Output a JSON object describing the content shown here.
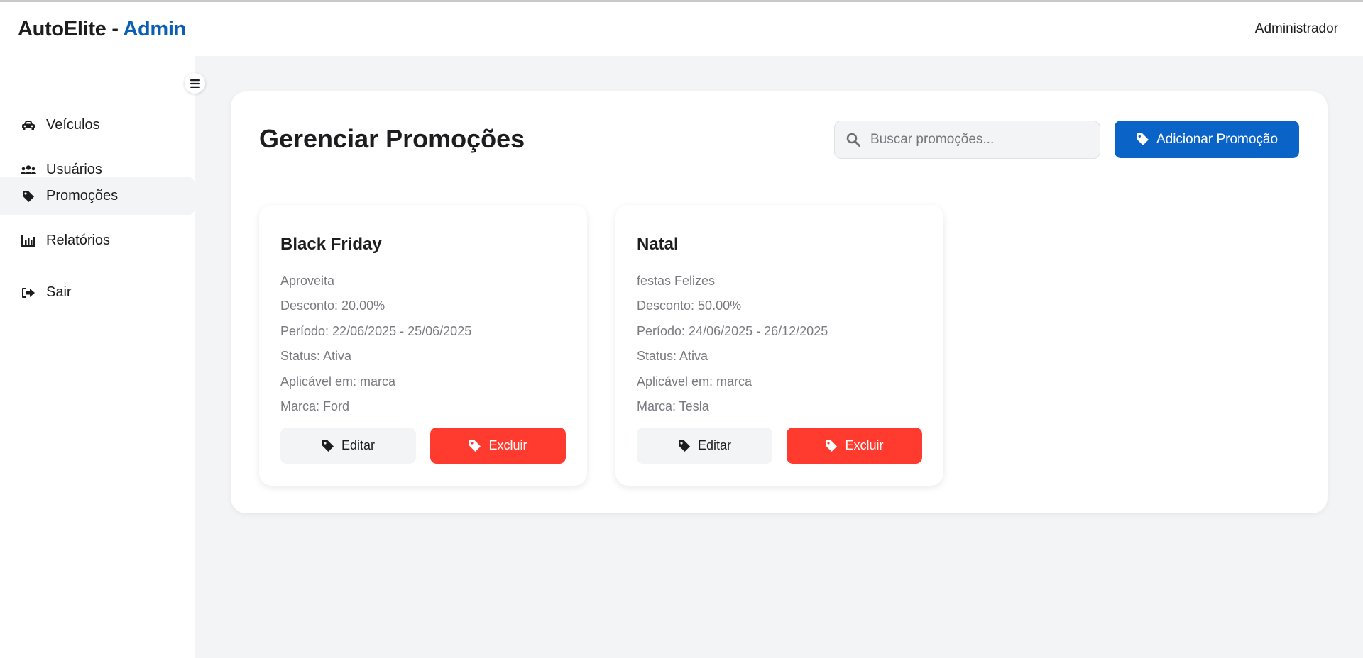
{
  "header": {
    "brand_main": "AutoElite",
    "brand_sep": " - ",
    "brand_accent": "Admin",
    "user_label": "Administrador"
  },
  "sidebar": {
    "items": [
      {
        "label": "Veículos",
        "icon": "car-icon"
      },
      {
        "label": "Usuários",
        "icon": "users-icon"
      },
      {
        "label": "Promoções",
        "icon": "tag-icon",
        "active": true
      },
      {
        "label": "Relatórios",
        "icon": "chart-icon"
      },
      {
        "label": "Sair",
        "icon": "logout-icon"
      }
    ]
  },
  "main": {
    "title": "Gerenciar Promoções",
    "search_placeholder": "Buscar promoções...",
    "add_button": "Adicionar Promoção",
    "cards": [
      {
        "title": "Black Friday",
        "description": "Aproveita",
        "discount": "Desconto: 20.00%",
        "period": "Período: 22/06/2025 - 25/06/2025",
        "status": "Status: Ativa",
        "applies_to": "Aplicável em: marca",
        "brand": "Marca: Ford",
        "edit_label": "Editar",
        "delete_label": "Excluir"
      },
      {
        "title": "Natal",
        "description": "festas Felizes",
        "discount": "Desconto: 50.00%",
        "period": "Período: 24/06/2025 - 26/12/2025",
        "status": "Status: Ativa",
        "applies_to": "Aplicável em: marca",
        "brand": "Marca: Tesla",
        "edit_label": "Editar",
        "delete_label": "Excluir"
      }
    ]
  },
  "colors": {
    "brand_accent": "#0a5fb4",
    "primary_button": "#0a64c8",
    "danger_button": "#ff3b30",
    "background": "#f3f4f6"
  }
}
